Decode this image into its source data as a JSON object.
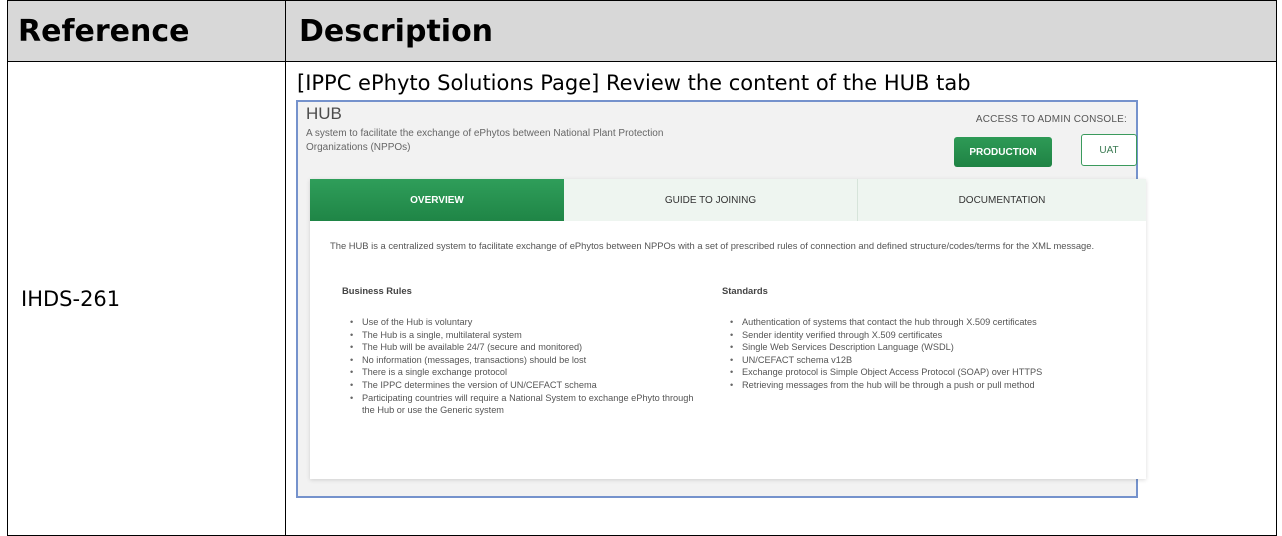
{
  "table": {
    "headers": {
      "reference": "Reference",
      "description": "Description"
    },
    "row": {
      "reference": "IHDS-261",
      "description": "[IPPC ePhyto Solutions Page] Review the content of the HUB tab"
    }
  },
  "screenshot": {
    "title": "HUB",
    "subtitle": "A system to facilitate the exchange of ePhytos between National Plant Protection Organizations (NPPOs)",
    "access_label": "ACCESS TO ADMIN CONSOLE:",
    "buttons": {
      "production": "PRODUCTION",
      "uat": "UAT"
    },
    "tabs": [
      {
        "label": "OVERVIEW",
        "active": true
      },
      {
        "label": "GUIDE TO JOINING",
        "active": false
      },
      {
        "label": "DOCUMENTATION",
        "active": false
      }
    ],
    "overview": "The HUB is a centralized system to facilitate exchange of ePhytos between NPPOs with a set of prescribed rules of connection and defined structure/codes/terms for the XML message.",
    "business_rules": {
      "title": "Business Rules",
      "items": [
        "Use of the Hub is voluntary",
        "The Hub is a single, multilateral system",
        "The Hub will be available 24/7 (secure and monitored)",
        "No information (messages, transactions) should be lost",
        "There is a single exchange protocol",
        "The IPPC determines the version of UN/CEFACT schema",
        "Participating countries will require a National System to exchange ePhyto through the Hub or use the Generic system"
      ]
    },
    "standards": {
      "title": "Standards",
      "items": [
        "Authentication of systems that contact the hub through X.509 certificates",
        "Sender identity verified through X.509 certificates",
        "Single Web Services Description Language (WSDL)",
        "UN/CEFACT schema v12B",
        "Exchange protocol is Simple Object Access Protocol (SOAP) over HTTPS",
        "Retrieving messages from the hub will be through a push or pull method"
      ]
    },
    "colors": {
      "green": "#1f8546",
      "tab_bg": "#eef5f0",
      "border_blue": "#7592cc"
    }
  }
}
